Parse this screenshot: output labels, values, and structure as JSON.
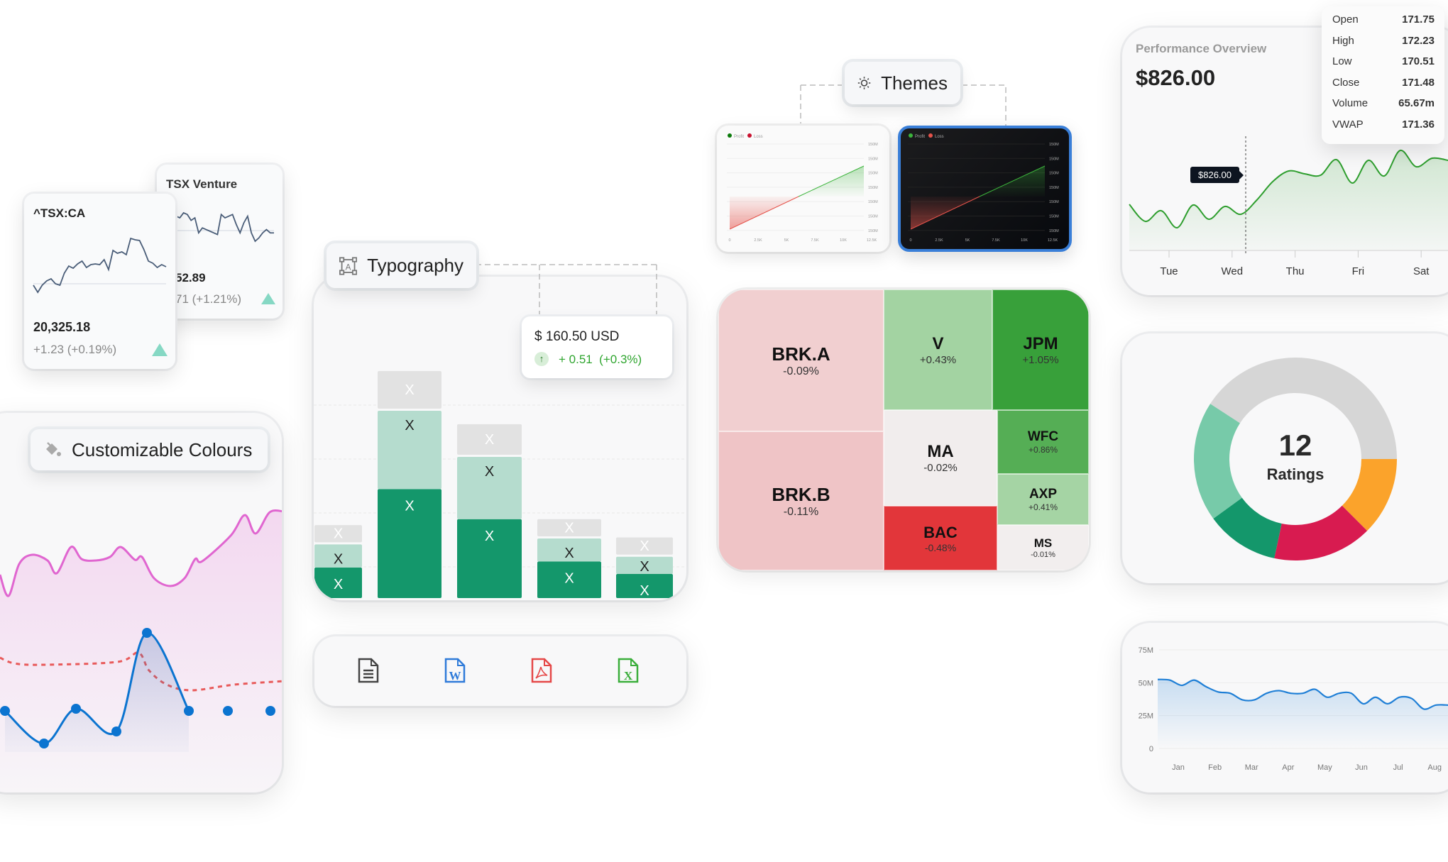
{
  "tsx_venture": {
    "title": "TSX Venture",
    "value": "52.89",
    "change": "71 (+1.21%)",
    "trend": "up",
    "sparkline": [
      60,
      58,
      64,
      62,
      55,
      58,
      40,
      46,
      44,
      42,
      40,
      38,
      62,
      58,
      60,
      62,
      50,
      40,
      52,
      60,
      40,
      30,
      34,
      40,
      44,
      40,
      40
    ]
  },
  "tsx_ca": {
    "title": "^TSX:CA",
    "value": "20,325.18",
    "change": "+1.23 (+0.19%)",
    "trend": "up",
    "sparkline": [
      18,
      8,
      18,
      24,
      27,
      20,
      18,
      35,
      45,
      42,
      48,
      52,
      43,
      47,
      48,
      47,
      54,
      40,
      67,
      63,
      65,
      61,
      84,
      82,
      81,
      68,
      52,
      49,
      43,
      47,
      44
    ]
  },
  "colours": {
    "label": "Customizable Colours",
    "icon": "paint-bucket-icon",
    "series_colors": {
      "area": "#E066D0",
      "dashed": "#E85A5A",
      "points": "#0B74D0"
    }
  },
  "typography": {
    "label": "Typography",
    "icon": "text-frame-icon",
    "price_tooltip": {
      "price": "$ 160.50 USD",
      "change": "+ 0.51  (+0.3%)",
      "direction": "up"
    }
  },
  "exports": [
    {
      "icon": "document-icon",
      "color": "#444444"
    },
    {
      "icon": "word-file-icon",
      "color": "#2F7BD9"
    },
    {
      "icon": "pdf-file-icon",
      "color": "#E54848"
    },
    {
      "icon": "excel-file-icon",
      "color": "#3BAE3B"
    }
  ],
  "themes": {
    "label": "Themes",
    "icon": "sun-icon",
    "legend": [
      "Profit",
      "Loss"
    ],
    "y_ticks": [
      "150M",
      "150M",
      "150M",
      "150M",
      "150M",
      "150M",
      "150M"
    ],
    "x_ticks": [
      "0",
      "2.5K",
      "5K",
      "7.5K",
      "10K",
      "12.5K"
    ],
    "variants": [
      "light",
      "dark"
    ]
  },
  "treemap": [
    {
      "ticker": "BRK.A",
      "change": "-0.09%",
      "color": "#F1CFD0"
    },
    {
      "ticker": "BRK.B",
      "change": "-0.11%",
      "color": "#EFC4C6"
    },
    {
      "ticker": "V",
      "change": "+0.43%",
      "color": "#A3D3A2"
    },
    {
      "ticker": "JPM",
      "change": "+1.05%",
      "color": "#38A03A"
    },
    {
      "ticker": "MA",
      "change": "-0.02%",
      "color": "#F1EDED"
    },
    {
      "ticker": "BAC",
      "change": "-0.48%",
      "color": "#E2363A"
    },
    {
      "ticker": "WFC",
      "change": "+0.86%",
      "color": "#55AE55"
    },
    {
      "ticker": "AXP",
      "change": "+0.41%",
      "color": "#A5D4A4"
    },
    {
      "ticker": "MS",
      "change": "-0.01%",
      "color": "#F2EEEE"
    }
  ],
  "performance": {
    "title": "Performance Overview",
    "value": "$826.00",
    "hover_label": "$826.00",
    "x_ticks": [
      "Tue",
      "Wed",
      "Thu",
      "Fri",
      "Sat"
    ],
    "ohlc": [
      {
        "label": "Open",
        "value": "171.75"
      },
      {
        "label": "High",
        "value": "172.23"
      },
      {
        "label": "Low",
        "value": "170.51"
      },
      {
        "label": "Close",
        "value": "171.48"
      },
      {
        "label": "Volume",
        "value": "65.67m"
      },
      {
        "label": "VWAP",
        "value": "171.36"
      }
    ]
  },
  "ratings": {
    "count": "12",
    "label": "Ratings"
  },
  "chart_data": [
    {
      "type": "bar",
      "stacked": true,
      "bar_labels": "X",
      "series": [
        {
          "values": [
            0.57,
            2.03,
            1.47,
            0.68,
            0.45
          ],
          "color": "#14976B"
        },
        {
          "values": [
            0.47,
            1.5,
            1.2,
            0.47,
            0.36
          ],
          "color": "#B5DCCE"
        },
        {
          "values": [
            0.36,
            0.74,
            0.61,
            0.36,
            0.36
          ],
          "color": "#E2E2E2"
        }
      ],
      "ylim": [
        0,
        4.6
      ],
      "grid": true
    },
    {
      "type": "area",
      "values": [
        65,
        41,
        56,
        32,
        64,
        44,
        62,
        51,
        71,
        97,
        112,
        108,
        106,
        128,
        95,
        127,
        105,
        141,
        118,
        130,
        127
      ],
      "x_ticks": [
        "Tue",
        "Wed",
        "Thu",
        "Fri",
        "Sat"
      ],
      "color": "#2E9E2E"
    },
    {
      "type": "pie",
      "donut": true,
      "values": [
        1.5,
        1.9,
        1.4,
        2.3,
        4.9
      ],
      "colors": [
        "#FBA32B",
        "#D81B50",
        "#14976B",
        "#77CAA9",
        "#D6D6D6"
      ],
      "center_text": "12 Ratings"
    },
    {
      "type": "area",
      "categories": [
        "Jan",
        "Feb",
        "Mar",
        "Apr",
        "May",
        "Jun",
        "Jul",
        "Aug"
      ],
      "y_ticks": [
        "75M",
        "50M",
        "25M",
        "0"
      ],
      "ylim": [
        0,
        75
      ],
      "values": [
        52.5,
        52,
        48,
        52,
        47,
        43,
        42,
        37,
        37,
        42,
        44,
        42,
        42,
        45,
        39,
        42,
        42,
        34,
        39,
        34,
        39,
        38,
        30,
        33,
        33
      ],
      "color": "#1F7FD6"
    },
    {
      "type": "line",
      "title": "",
      "legend": [
        "Profit",
        "Loss"
      ],
      "x_ticks": [
        "0",
        "2.5K",
        "5K",
        "7.5K",
        "10K",
        "12.5K"
      ],
      "y_ticks": [
        "150M",
        "150M",
        "150M",
        "150M",
        "150M",
        "150M",
        "150M"
      ]
    }
  ]
}
